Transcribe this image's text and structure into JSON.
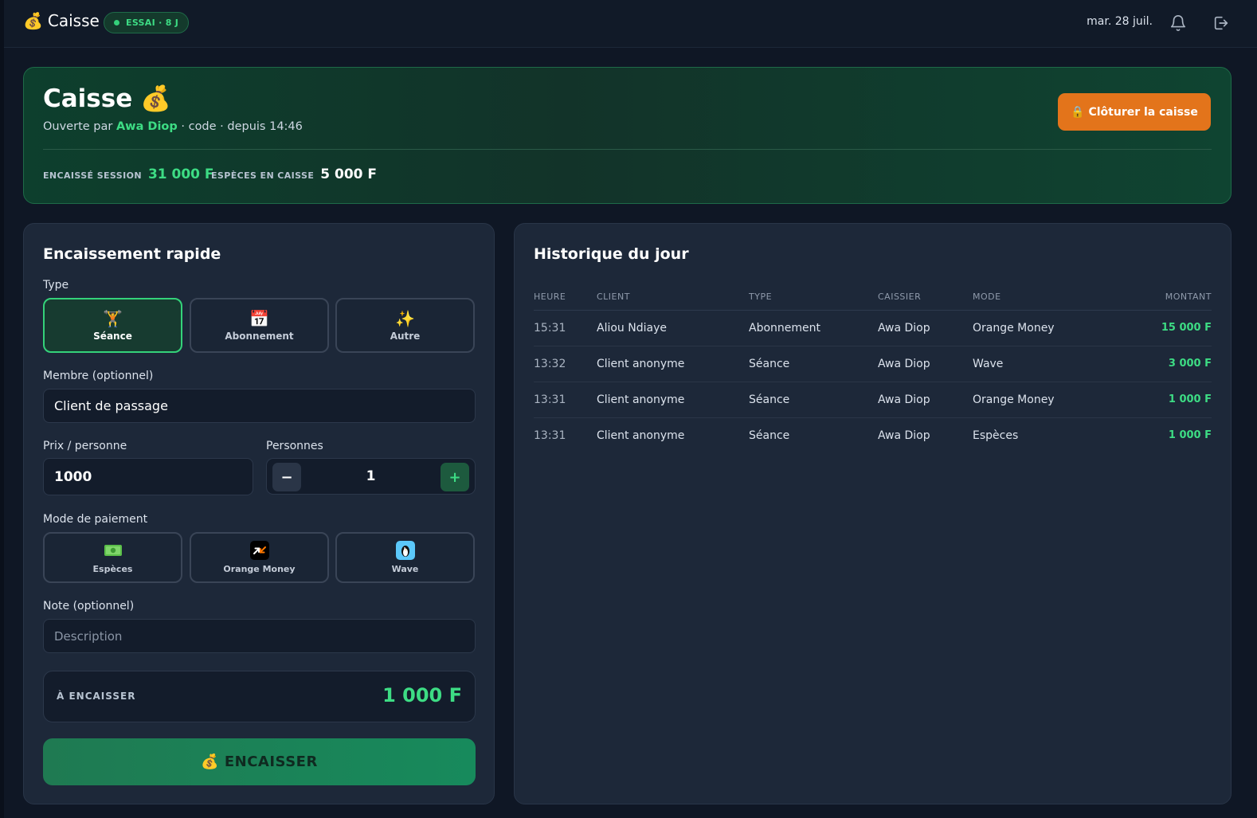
{
  "topbar": {
    "brand_emoji": "💰",
    "brand_name": "Caisse",
    "trial_badge": "ESSAI · 8 J",
    "date": "mar. 28 juil.",
    "icons": [
      "bell-icon",
      "logout-icon"
    ]
  },
  "session": {
    "title": "Caisse",
    "title_emoji": "💰",
    "opened_prefix": "Ouverte par",
    "opened_by": "Awa Diop",
    "opened_suffix": "· code · depuis 14:46",
    "close_button": "🔒 Clôturer la caisse",
    "stats": [
      {
        "label": "ENCAISSÉ SESSION",
        "value": "31 000 F"
      },
      {
        "label": "ESPÈCES EN CAISSE",
        "value": "5 000 F"
      }
    ]
  },
  "quick": {
    "title": "Encaissement rapide",
    "type_label": "Type",
    "types": [
      {
        "icon": "🏋️",
        "label": "Séance",
        "selected": true
      },
      {
        "icon": "📅",
        "label": "Abonnement",
        "selected": false
      },
      {
        "icon": "✨",
        "label": "Autre",
        "selected": false
      }
    ],
    "member_label": "Membre (optionnel)",
    "member_value": "Client de passage",
    "price_label": "Prix / personne",
    "price_value": "1000",
    "persons_label": "Personnes",
    "persons_value": "1",
    "minus": "−",
    "plus": "+",
    "payment_label": "Mode de paiement",
    "payments": [
      {
        "label": "Espèces",
        "icon": "banknote-icon"
      },
      {
        "label": "Orange Money",
        "icon": "orange-money-icon"
      },
      {
        "label": "Wave",
        "icon": "wave-penguin-icon"
      }
    ],
    "note_label": "Note (optionnel)",
    "note_placeholder": "Description",
    "total_label": "À ENCAISSER",
    "total_value": "1 000 F",
    "submit": "💰 ENCAISSER",
    "accent_color": "#3ddc84"
  },
  "history": {
    "title": "Historique du jour",
    "columns": [
      "HEURE",
      "CLIENT",
      "TYPE",
      "CAISSIER",
      "MODE",
      "MONTANT"
    ],
    "rows": [
      {
        "time": "15:31",
        "client": "Aliou Ndiaye",
        "type": "Abonnement",
        "cashier": "Awa Diop",
        "mode": "Orange Money",
        "amount": "15 000 F"
      },
      {
        "time": "13:32",
        "client": "Client anonyme",
        "type": "Séance",
        "cashier": "Awa Diop",
        "mode": "Wave",
        "amount": "3 000 F"
      },
      {
        "time": "13:31",
        "client": "Client anonyme",
        "type": "Séance",
        "cashier": "Awa Diop",
        "mode": "Orange Money",
        "amount": "1 000 F"
      },
      {
        "time": "13:31",
        "client": "Client anonyme",
        "type": "Séance",
        "cashier": "Awa Diop",
        "mode": "Espèces",
        "amount": "1 000 F"
      }
    ]
  }
}
